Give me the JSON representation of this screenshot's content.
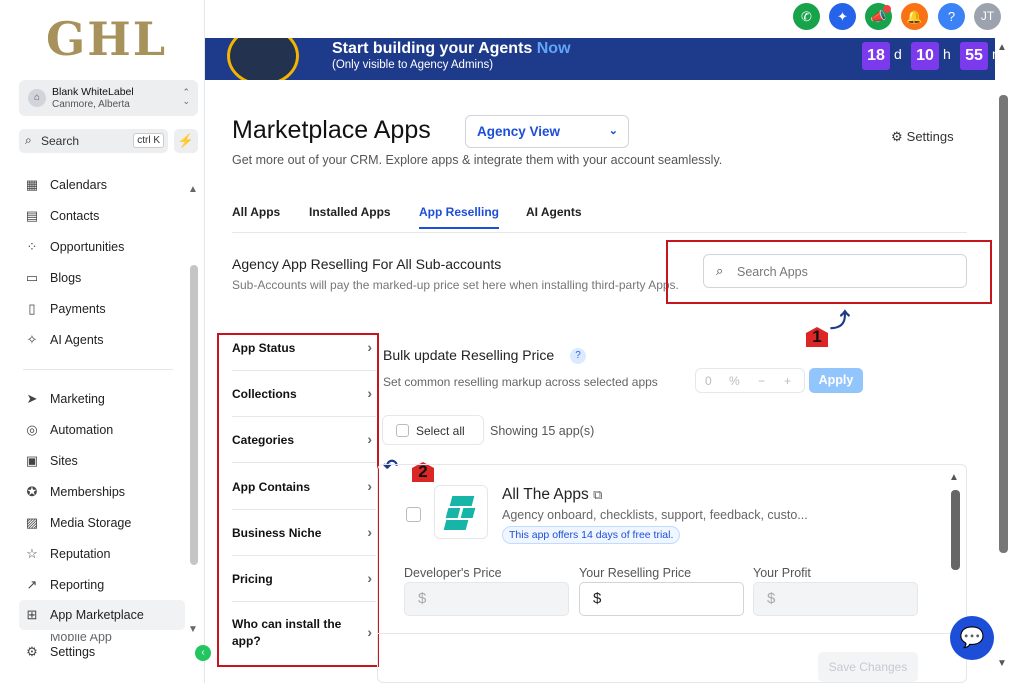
{
  "sidebar": {
    "logo": "GHL",
    "account": {
      "name": "Blank WhiteLabel",
      "location": "Canmore, Alberta"
    },
    "search": {
      "label": "Search",
      "shortcut": "ctrl K"
    },
    "items_top": [
      {
        "label": "Calendars",
        "icon": "calendar-icon"
      },
      {
        "label": "Contacts",
        "icon": "contacts-icon"
      },
      {
        "label": "Opportunities",
        "icon": "opportunities-icon"
      },
      {
        "label": "Blogs",
        "icon": "blogs-icon"
      },
      {
        "label": "Payments",
        "icon": "payments-icon"
      },
      {
        "label": "AI Agents",
        "icon": "sparkle-icon"
      }
    ],
    "items_bottom": [
      {
        "label": "Marketing",
        "icon": "send-icon"
      },
      {
        "label": "Automation",
        "icon": "automation-icon"
      },
      {
        "label": "Sites",
        "icon": "sites-icon"
      },
      {
        "label": "Memberships",
        "icon": "award-icon"
      },
      {
        "label": "Media Storage",
        "icon": "image-icon"
      },
      {
        "label": "Reputation",
        "icon": "star-icon"
      },
      {
        "label": "Reporting",
        "icon": "trend-icon"
      },
      {
        "label": "App Marketplace",
        "icon": "grid-icon"
      }
    ],
    "partial_item": "Mobile App",
    "settings_label": "Settings"
  },
  "topbar": {
    "avatar": "JT"
  },
  "banner": {
    "title": "Start building your Agents",
    "title_highlight": "Now",
    "subtitle": "(Only visible to Agency Admins)",
    "countdown": [
      {
        "value": "18",
        "unit": "d"
      },
      {
        "value": "10",
        "unit": "h"
      },
      {
        "value": "55",
        "unit": "m"
      }
    ]
  },
  "page": {
    "title": "Marketplace Apps",
    "view_select": "Agency View",
    "subtitle": "Get more out of your CRM. Explore apps & integrate them with your account seamlessly.",
    "settings_label": "Settings",
    "tabs": [
      "All Apps",
      "Installed Apps",
      "App Reselling",
      "AI Agents"
    ],
    "active_tab": "App Reselling",
    "section_title": "Agency App Reselling For All Sub-accounts",
    "section_desc": "Sub-Accounts will pay the marked-up price set here when installing third-party Apps.",
    "search_placeholder": "Search Apps",
    "filters": [
      "App Status",
      "Collections",
      "Categories",
      "App Contains",
      "Business Niche",
      "Pricing",
      "Who can install the app?"
    ],
    "bulk": {
      "title": "Bulk update Reselling Price",
      "help": "?",
      "desc": "Set common reselling markup across selected apps",
      "value": "0",
      "unit": "%",
      "minus": "−",
      "plus": "+",
      "apply": "Apply"
    },
    "select_all": "Select all",
    "showing": "Showing 15 app(s)",
    "app_card": {
      "name": "All The Apps",
      "desc": "Agency onboard, checklists, support, feedback, custo...",
      "trial": "This app offers 14 days of free trial.",
      "dev_price_label": "Developer's Price",
      "resell_price_label": "Your Reselling Price",
      "profit_label": "Your Profit",
      "currency": "$",
      "save": "Save Changes"
    },
    "annotations": [
      "1",
      "2"
    ]
  },
  "colors": {
    "accent": "#1d4ed8",
    "annotation": "#c4161c",
    "banner": "#1e3a8a",
    "countdown": "#7c3aed"
  }
}
